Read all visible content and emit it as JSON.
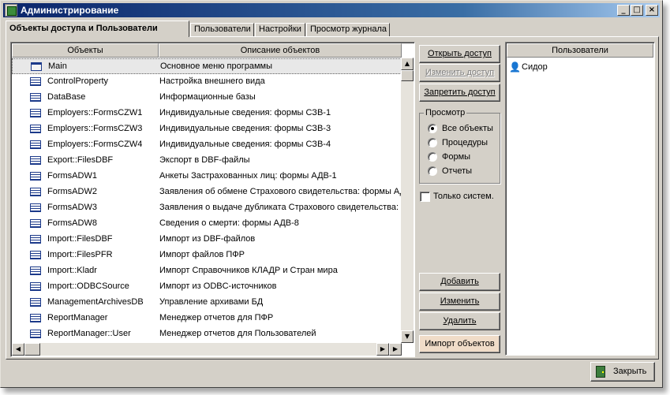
{
  "window": {
    "title": "Администрирование"
  },
  "titlebar_buttons": {
    "minimize": "_",
    "maximize": "□",
    "close": "×"
  },
  "tabs": [
    {
      "label": "Объекты доступа и Пользователи",
      "active": true
    },
    {
      "label": "Пользователи",
      "active": false
    },
    {
      "label": "Настройки",
      "active": false
    },
    {
      "label": "Просмотр журнала",
      "active": false
    }
  ],
  "objects_grid": {
    "columns": [
      "Объекты",
      "Описание объектов"
    ],
    "rows": [
      {
        "name": "Main",
        "description": "Основное меню программы",
        "icon": "form-empty-icon",
        "selected": true
      },
      {
        "name": "ControlProperty",
        "description": "Настройка внешнего вида",
        "icon": "table-icon"
      },
      {
        "name": "DataBase",
        "description": "Информационные базы",
        "icon": "table-icon"
      },
      {
        "name": "Employers::FormsCZW1",
        "description": "Индивидуальные сведения: формы СЗВ-1",
        "icon": "table-icon"
      },
      {
        "name": "Employers::FormsCZW3",
        "description": "Индивидуальные сведения: формы СЗВ-3",
        "icon": "table-icon"
      },
      {
        "name": "Employers::FormsCZW4",
        "description": "Индивидуальные сведения: формы СЗВ-4",
        "icon": "table-icon"
      },
      {
        "name": "Export::FilesDBF",
        "description": "Экспорт в DBF-файлы",
        "icon": "table-icon"
      },
      {
        "name": "FormsADW1",
        "description": "Анкеты Застрахованных лиц: формы АДВ-1",
        "icon": "table-icon"
      },
      {
        "name": "FormsADW2",
        "description": "Заявления об обмене Страхового свидетельства: формы АД",
        "icon": "table-icon"
      },
      {
        "name": "FormsADW3",
        "description": "Заявления о выдаче дубликата Страхового свидетельства: ф",
        "icon": "table-icon"
      },
      {
        "name": "FormsADW8",
        "description": "Сведения о смерти: формы АДВ-8",
        "icon": "table-icon"
      },
      {
        "name": "Import::FilesDBF",
        "description": "Импорт из DBF-файлов",
        "icon": "table-icon"
      },
      {
        "name": "Import::FilesPFR",
        "description": "Импорт файлов ПФР",
        "icon": "table-icon"
      },
      {
        "name": "Import::Kladr",
        "description": "Импорт Справочников КЛАДР и Стран мира",
        "icon": "table-icon"
      },
      {
        "name": "Import::ODBCSource",
        "description": "Импорт из ODBC-источников",
        "icon": "table-icon"
      },
      {
        "name": "ManagementArchivesDB",
        "description": "Управление архивами БД",
        "icon": "table-icon"
      },
      {
        "name": "ReportManager",
        "description": "Менеджер отчетов для ПФР",
        "icon": "table-icon"
      },
      {
        "name": "ReportManager::User",
        "description": "Менеджер отчетов для Пользователей",
        "icon": "table-icon"
      }
    ]
  },
  "access_buttons": {
    "open": "Открыть доступ",
    "change": "Изменить доступ",
    "deny": "Запретить доступ"
  },
  "view_group": {
    "title": "Просмотр",
    "options": [
      {
        "label": "Все объекты",
        "checked": true
      },
      {
        "label": "Процедуры",
        "checked": false
      },
      {
        "label": "Формы",
        "checked": false
      },
      {
        "label": "Отчеты",
        "checked": false
      }
    ]
  },
  "system_only": {
    "label": "Только систем.",
    "checked": false
  },
  "object_buttons": {
    "add": "Добавить",
    "edit": "Изменить",
    "delete": "Удалить",
    "import": "Импорт объектов"
  },
  "users_panel": {
    "header": "Пользователи",
    "items": [
      {
        "label": "Сидор",
        "icon": "user-icon"
      }
    ]
  },
  "footer": {
    "close": "Закрыть"
  },
  "scroll_arrows": {
    "up": "▲",
    "down": "▼",
    "left": "◀",
    "right": "▶"
  },
  "user_glyph": "👤"
}
